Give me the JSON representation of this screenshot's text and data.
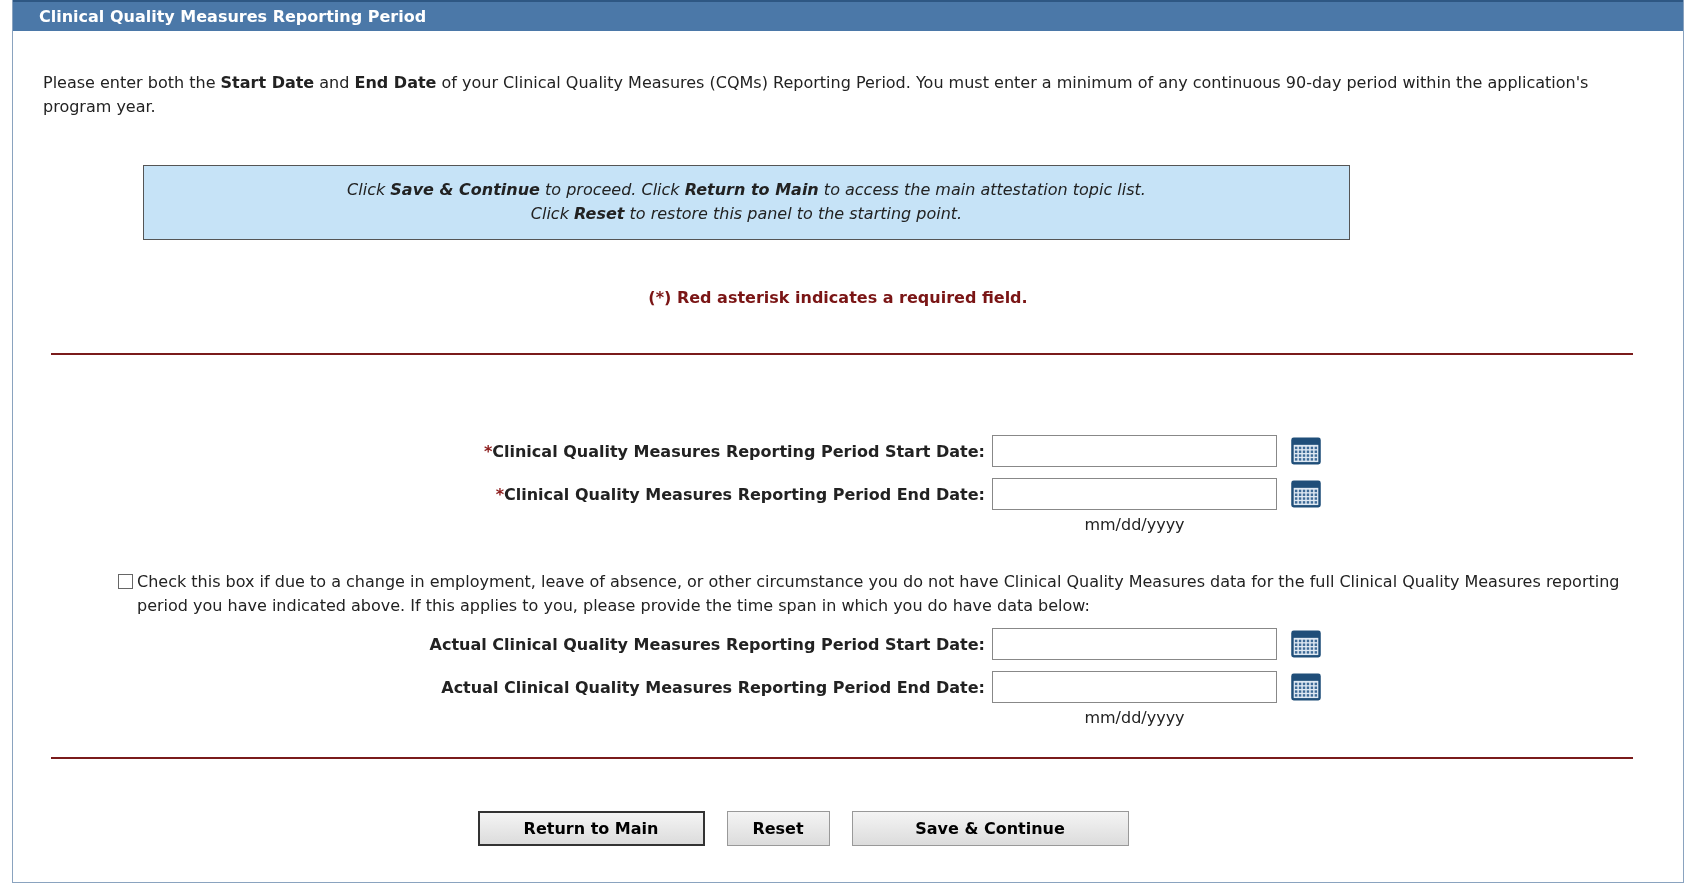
{
  "panel": {
    "title": "Clinical Quality Measures Reporting Period"
  },
  "intro": "Please enter both the **Start Date** and **End Date** of your Clinical Quality Measures (CQMs) Reporting Period. You must enter a minimum of any continuous 90-day period within the application's program year.",
  "info_lines": [
    "Click **Save & Continue** to proceed. Click **Return to Main** to access the main attestation topic list.",
    "Click **Reset** to restore this panel to the starting point."
  ],
  "required_note": "(*) Red asterisk indicates a required field.",
  "required_fields": [
    {
      "required_mark": "*",
      "label": "Clinical Quality Measures Reporting Period Start Date:"
    },
    {
      "required_mark": "*",
      "label": "Clinical Quality Measures Reporting Period End Date:"
    }
  ],
  "required_format_hint": "mm/dd/yyyy",
  "partial_data_checkbox": {
    "checked": false,
    "label": "Check this box if due to a change in employment, leave of absence, or other circumstance you do not have Clinical Quality Measures data for the full Clinical Quality Measures reporting period you have indicated above. If this applies to you, please provide the time span in which you do have data below:"
  },
  "actual_fields": [
    {
      "label": "Actual Clinical Quality Measures Reporting Period Start Date:"
    },
    {
      "label": "Actual Clinical Quality Measures Reporting Period End Date:"
    }
  ],
  "actual_format_hint": "mm/dd/yyyy",
  "buttons": [
    {
      "label": "Return to Main",
      "default": true
    },
    {
      "label": "Reset",
      "default": false
    },
    {
      "label": "Save & Continue",
      "default": false
    }
  ]
}
